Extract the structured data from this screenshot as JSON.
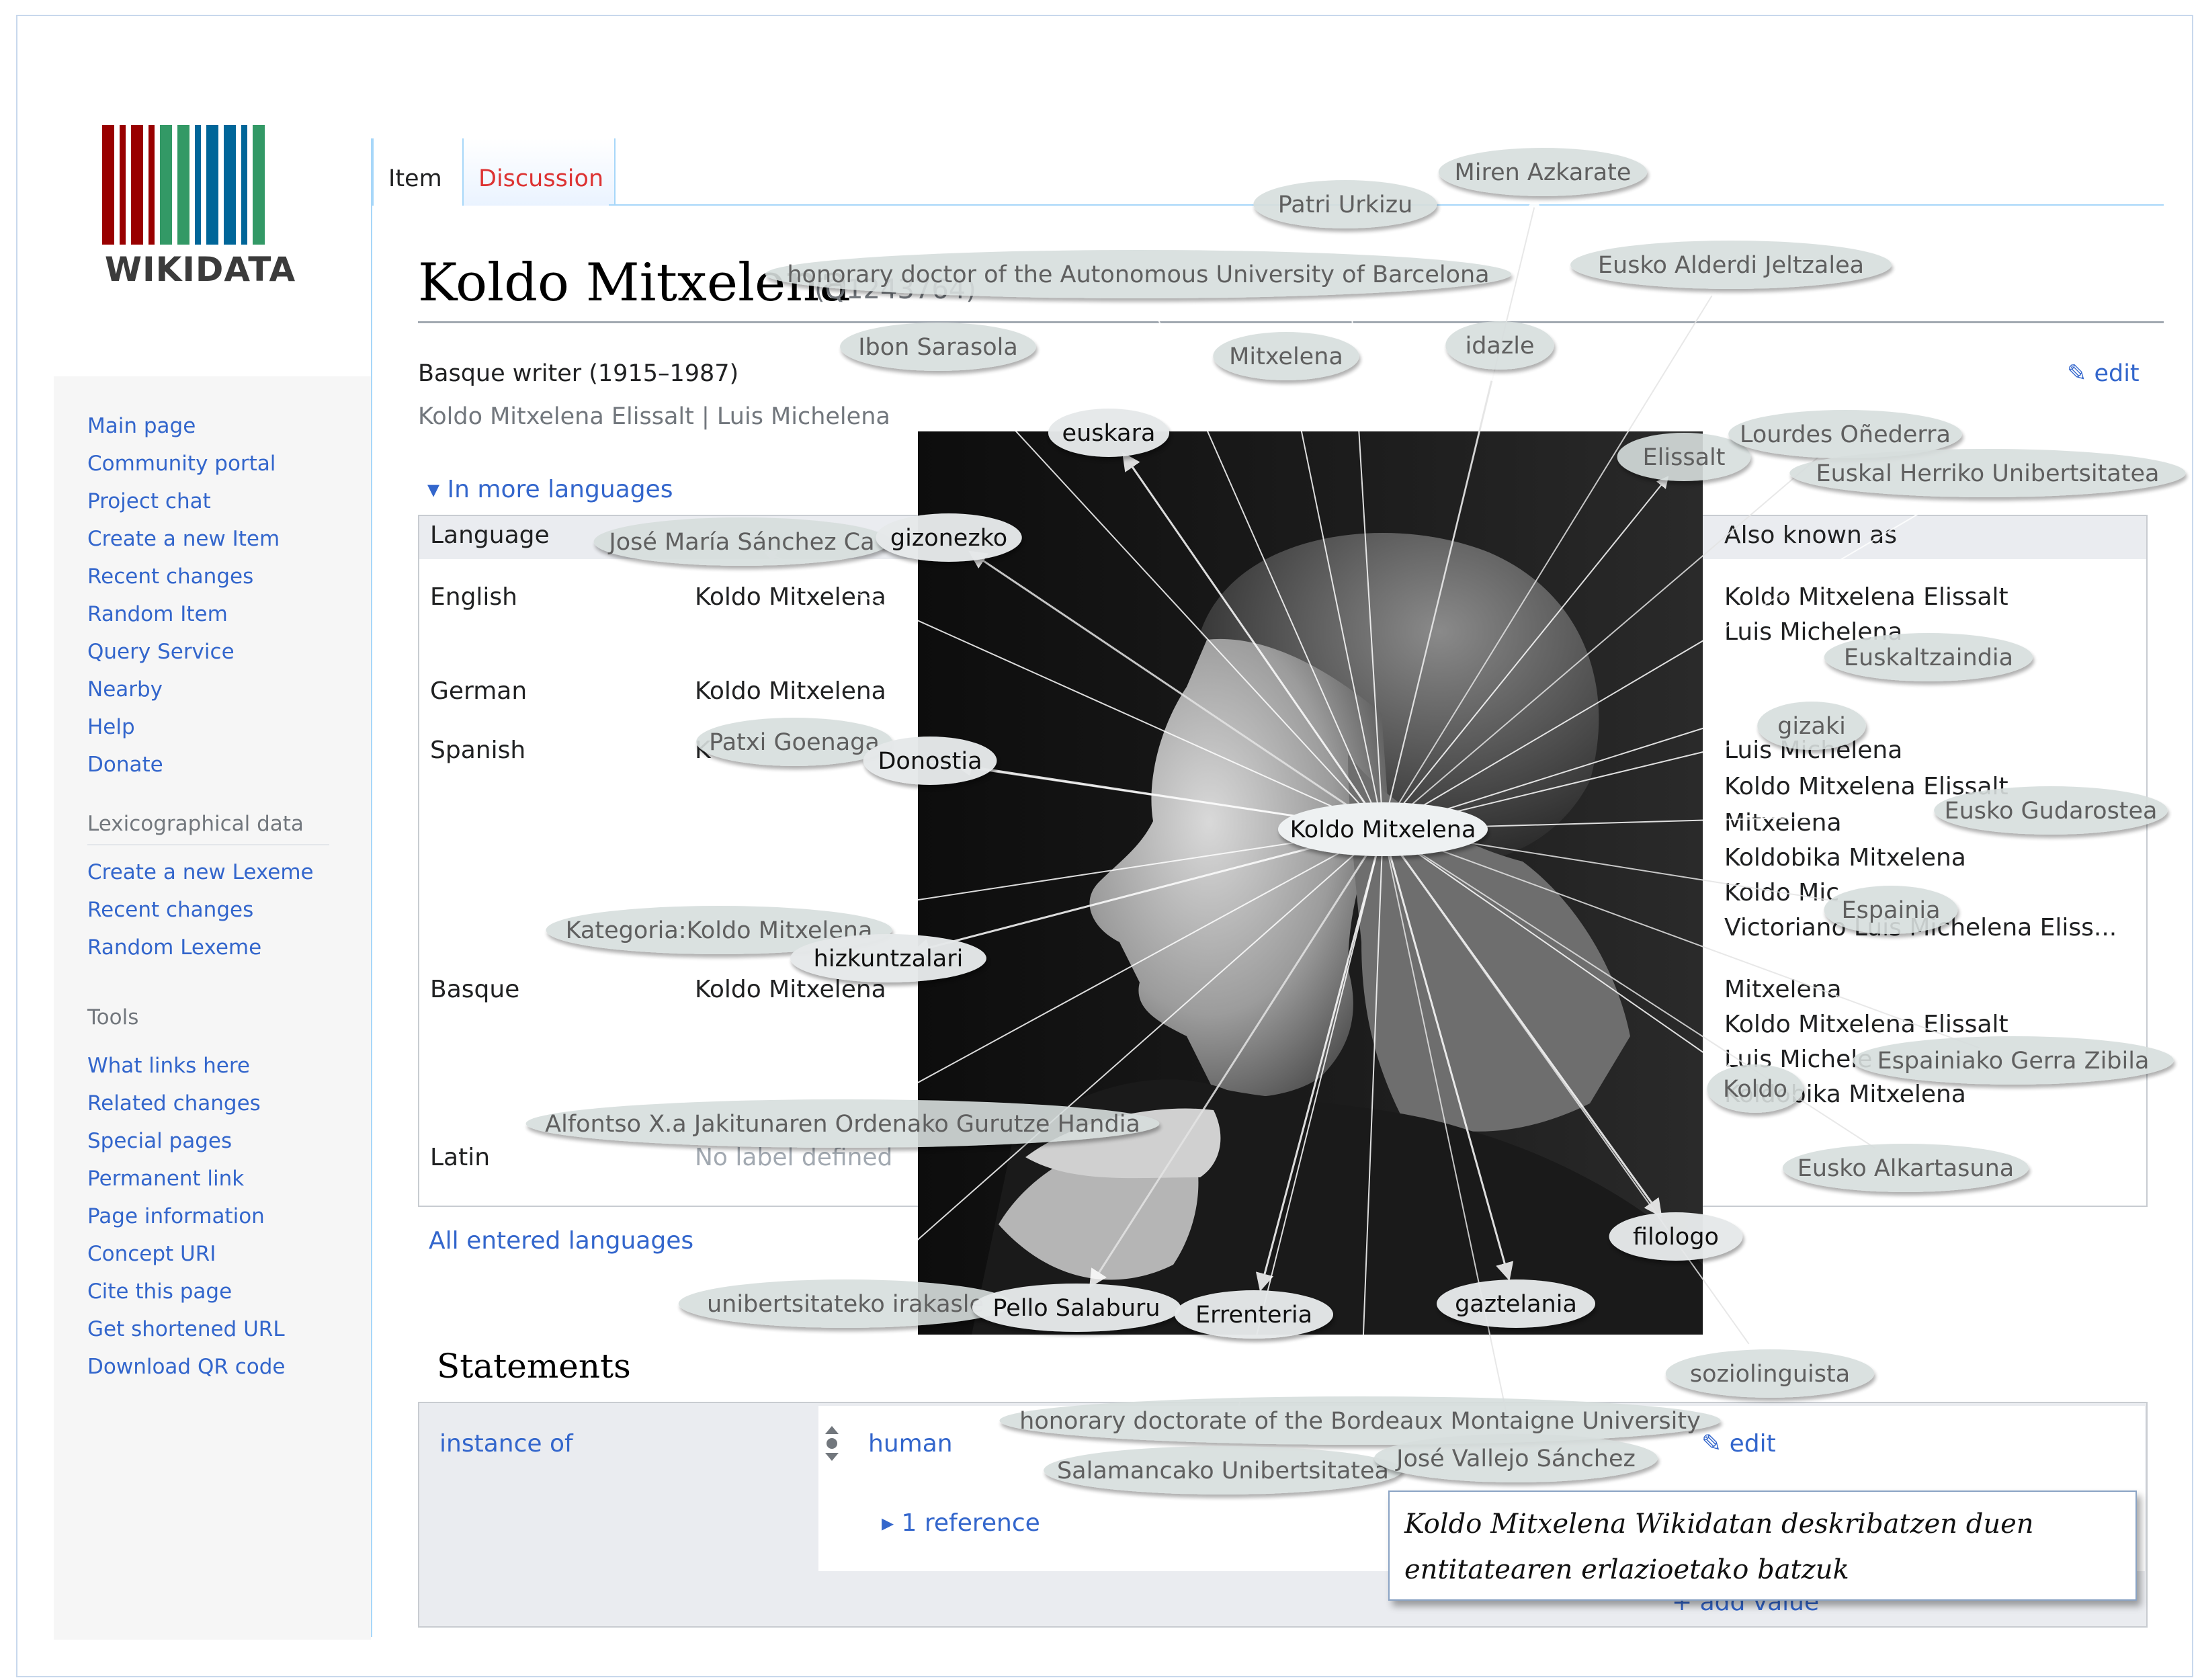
{
  "logo": {
    "wordmark": "WIKIDATA",
    "bar_colors": [
      "#990000",
      "#990000",
      "#990000",
      "#990000",
      "#339966",
      "#339966",
      "#006699",
      "#006699",
      "#006699",
      "#006699",
      "#339966"
    ]
  },
  "sidebar": {
    "main": [
      "Main page",
      "Community portal",
      "Project chat",
      "Create a new Item",
      "Recent changes",
      "Random Item",
      "Query Service",
      "Nearby",
      "Help",
      "Donate"
    ],
    "lexico_heading": "Lexicographical data",
    "lexico": [
      "Create a new Lexeme",
      "Recent changes",
      "Random Lexeme"
    ],
    "tools_heading": "Tools",
    "tools": [
      "What links here",
      "Related changes",
      "Special pages",
      "Permanent link",
      "Page information",
      "Concept URI",
      "Cite this page",
      "Get shortened URL",
      "Download QR code"
    ]
  },
  "tabs": {
    "item": "Item",
    "discussion": "Discussion"
  },
  "item": {
    "title": "Koldo Mitxelena",
    "id": "(Q1243764)",
    "description": "Basque writer (1915–1987)",
    "aliases": "Koldo Mitxelena Elissalt  |  Luis Michelena",
    "edit": "edit"
  },
  "languages": {
    "toggle": "In more languages",
    "col_language": "Language",
    "col_aka": "Also known as",
    "rows": [
      {
        "lang": "English",
        "label": "Koldo Mitxelena"
      },
      {
        "lang": "German",
        "label": "Koldo Mitxelena"
      },
      {
        "lang": "Spanish",
        "label": "K"
      },
      {
        "lang": "Basque",
        "label": "Koldo Mitxelena"
      },
      {
        "lang": "Latin",
        "label": "No label defined"
      }
    ],
    "aka_lines": [
      "Koldo Mitxelena Elissalt",
      "Luis Michelena",
      "Luis Michelena",
      "Koldo Mitxelena Elissalt",
      "Mitxelena",
      "Koldobika Mitxelena",
      "Koldo Mic",
      "Victoriano Luis Michelena Eliss...",
      "Mitxelena",
      "Koldo Mitxelena Elissalt",
      "Luis Michele",
      "Koldobika Mitxelena"
    ],
    "all_entered": "All entered languages"
  },
  "statements": {
    "heading": "Statements",
    "property": "instance of",
    "value": "human",
    "edit": "edit",
    "reference": "1 reference",
    "add_value": "add value"
  },
  "graph": {
    "center": "Koldo Mitxelena",
    "nodes": [
      {
        "label": "Miren Azkarate",
        "style": "light"
      },
      {
        "label": "Patri Urkizu",
        "style": "light"
      },
      {
        "label": "honorary doctor of the Autonomous University of Barcelona",
        "style": "light"
      },
      {
        "label": "Eusko Alderdi Jeltzalea",
        "style": "light"
      },
      {
        "label": "Ibon Sarasola",
        "style": "light"
      },
      {
        "label": "Mitxelena",
        "style": "light"
      },
      {
        "label": "idazle",
        "style": "light"
      },
      {
        "label": "euskara",
        "style": "bold"
      },
      {
        "label": "Elissalt",
        "style": "light"
      },
      {
        "label": "Lourdes Oñederra",
        "style": "light"
      },
      {
        "label": "Euskal Herriko Unibertsitatea",
        "style": "light"
      },
      {
        "label": "José María Sánchez Ca",
        "style": "light"
      },
      {
        "label": "gizonezko",
        "style": "bold"
      },
      {
        "label": "Euskaltzaindia",
        "style": "light"
      },
      {
        "label": "gizaki",
        "style": "light"
      },
      {
        "label": "Patxi Goenaga",
        "style": "light"
      },
      {
        "label": "Donostia",
        "style": "bold"
      },
      {
        "label": "Eusko Gudarostea",
        "style": "light"
      },
      {
        "label": "Espainia",
        "style": "light"
      },
      {
        "label": "Kategoria:Koldo Mitxelena",
        "style": "light"
      },
      {
        "label": "hizkuntzalari",
        "style": "bold"
      },
      {
        "label": "Espainiako Gerra Zibila",
        "style": "light"
      },
      {
        "label": "Koldo",
        "style": "light"
      },
      {
        "label": "Alfontso X.a Jakitunaren Ordenako Gurutze Handia",
        "style": "light"
      },
      {
        "label": "Eusko Alkartasuna",
        "style": "light"
      },
      {
        "label": "filologo",
        "style": "bold"
      },
      {
        "label": "unibertsitateko irakasle",
        "style": "light"
      },
      {
        "label": "Pello Salaburu",
        "style": "bold"
      },
      {
        "label": "Errenteria",
        "style": "bold"
      },
      {
        "label": "gaztelania",
        "style": "bold"
      },
      {
        "label": "soziolinguista",
        "style": "light"
      },
      {
        "label": "honorary doctorate of the Bordeaux Montaigne University",
        "style": "light"
      },
      {
        "label": "Salamancako Unibertsitatea",
        "style": "light"
      },
      {
        "label": "José Vallejo Sánchez",
        "style": "light"
      }
    ]
  },
  "caption": "Koldo Mitxelena Wikidatan deskribatzen duen entitatearen erlazioetako batzuk"
}
